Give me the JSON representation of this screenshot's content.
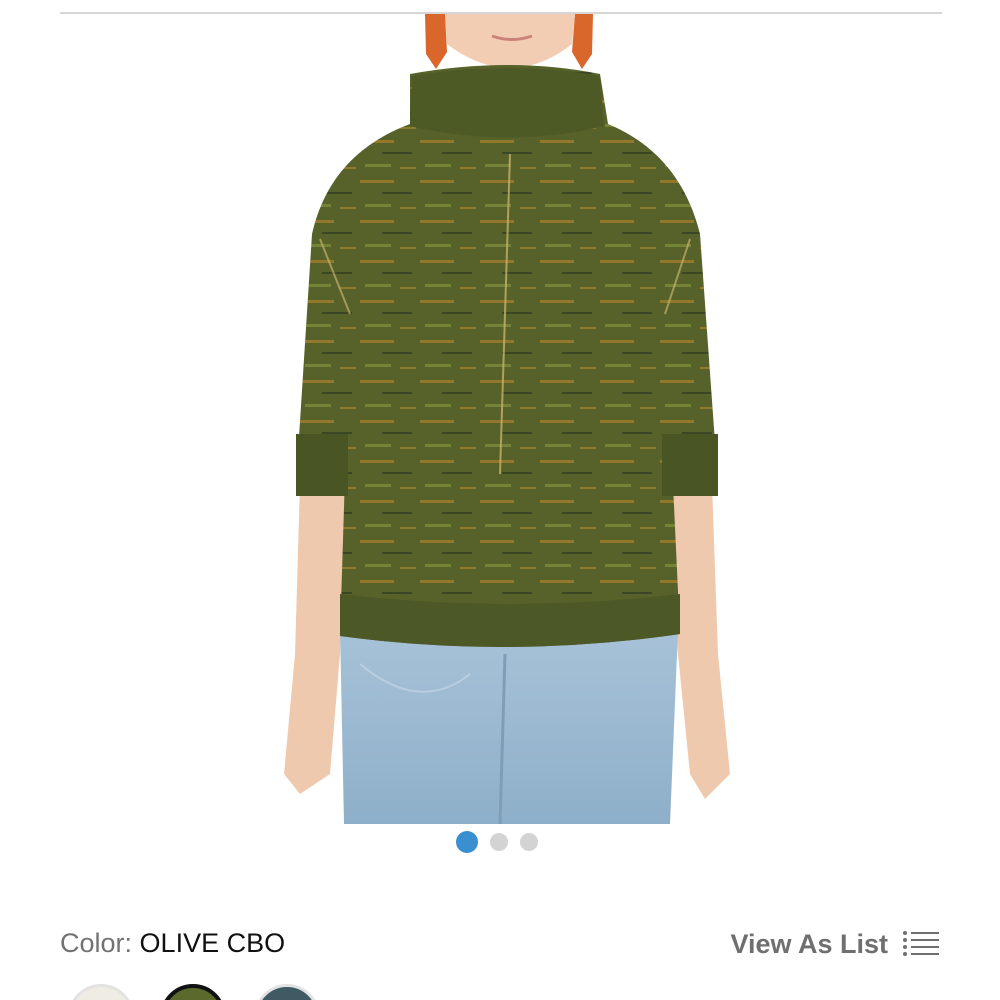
{
  "product": {
    "image_alt": "Women's olive space-dye mock neck sweater with light wash jeans",
    "carousel": {
      "total": 3,
      "active_index": 0
    }
  },
  "color": {
    "label": "Color:",
    "value": "OLIVE CBO"
  },
  "view_toggle": {
    "label": "View As List",
    "icon": "list-icon"
  },
  "swatches": [
    {
      "name": "swatch-ivory",
      "color": "#efece3"
    },
    {
      "name": "swatch-olive",
      "color": "#5b6a2c",
      "selected": true
    },
    {
      "name": "swatch-teal",
      "color": "#3f5a63"
    }
  ],
  "colors": {
    "accent": "#3a8fd0",
    "sweater": "#5e6b2a",
    "jeans": "#9fbdd6"
  }
}
